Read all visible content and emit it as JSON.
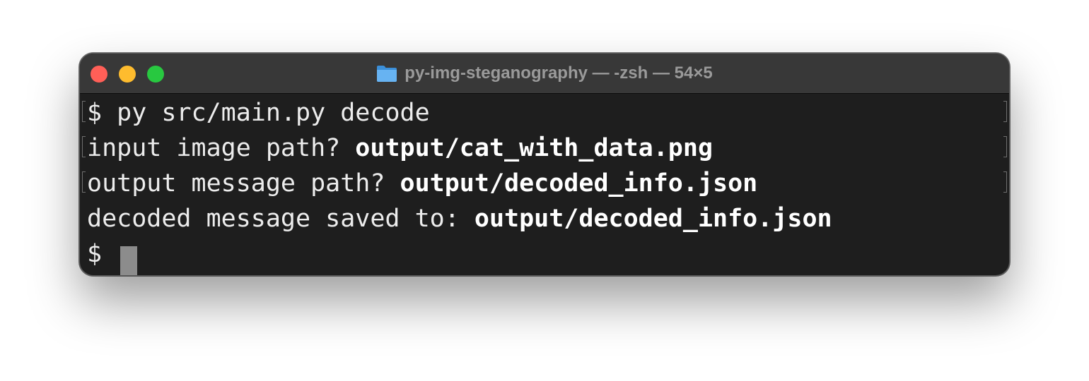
{
  "window": {
    "title": "py-img-steganography — -zsh — 54×5",
    "title_icon": "folder-icon",
    "buttons": [
      "close-button",
      "minimize-button",
      "zoom-button"
    ]
  },
  "terminal": {
    "lines": [
      {
        "prompt": "$ ",
        "plain": "py src/main.py decode",
        "bold": ""
      },
      {
        "prompt": "",
        "plain": "input image path? ",
        "bold": "output/cat_with_data.png"
      },
      {
        "prompt": "",
        "plain": "output message path? ",
        "bold": "output/decoded_info.json"
      },
      {
        "prompt": "",
        "plain": "decoded message saved to: ",
        "bold": "output/decoded_info.json"
      },
      {
        "prompt": "$ ",
        "plain": "",
        "bold": ""
      }
    ]
  },
  "colors": {
    "background": "#1e1e1e",
    "titlebar": "#383838",
    "close": "#ff5f57",
    "minimize": "#febc2e",
    "zoom": "#28c840",
    "text": "#ececec",
    "cursor": "#8c8c8c"
  }
}
